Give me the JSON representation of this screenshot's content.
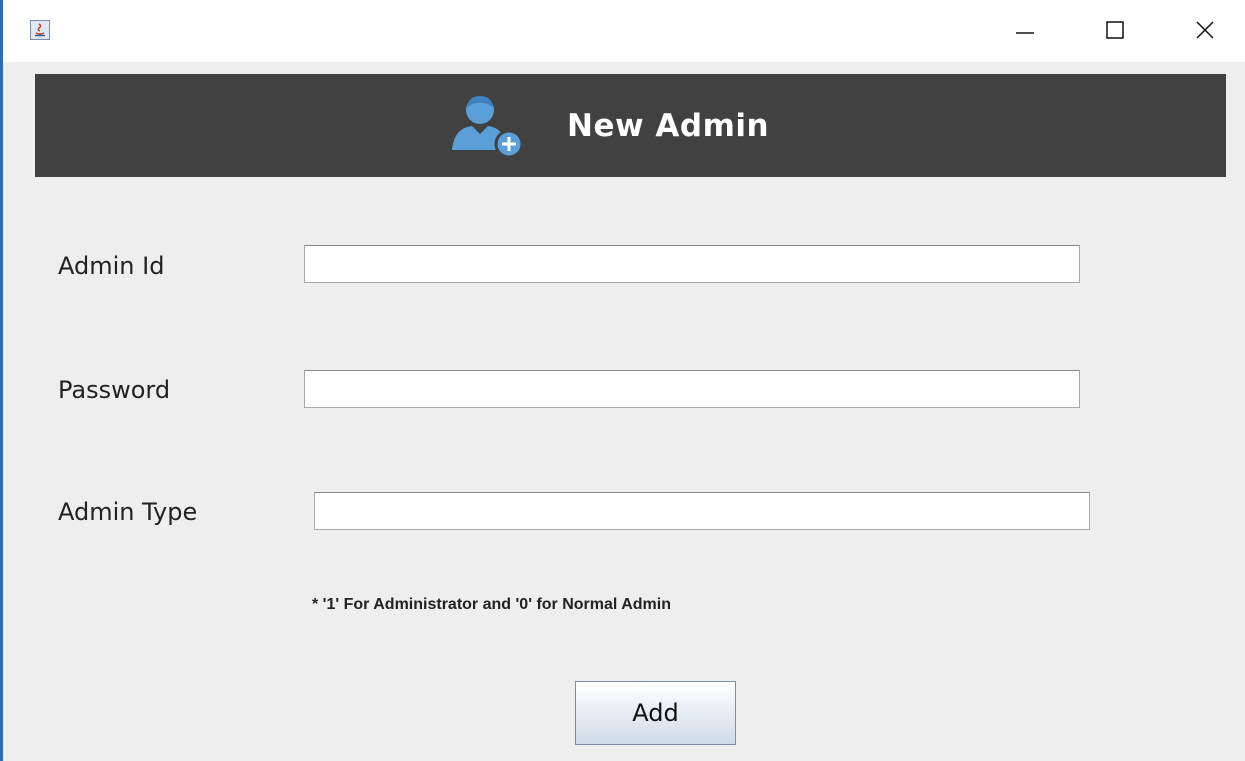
{
  "window": {
    "controls": {
      "minimize_icon": "minimize-icon",
      "maximize_icon": "maximize-icon",
      "close_icon": "close-icon"
    },
    "app_icon": "java-app-icon"
  },
  "header": {
    "title": "New Admin",
    "icon": "user-add-icon",
    "background": "#414141",
    "icon_color": "#5a9fd8"
  },
  "form": {
    "fields": [
      {
        "label": "Admin Id",
        "value": "",
        "placeholder": ""
      },
      {
        "label": "Password",
        "value": "",
        "placeholder": ""
      },
      {
        "label": "Admin Type",
        "value": "",
        "placeholder": ""
      }
    ],
    "hint": "* '1' For Administrator and '0' for Normal Admin",
    "submit_label": "Add"
  }
}
